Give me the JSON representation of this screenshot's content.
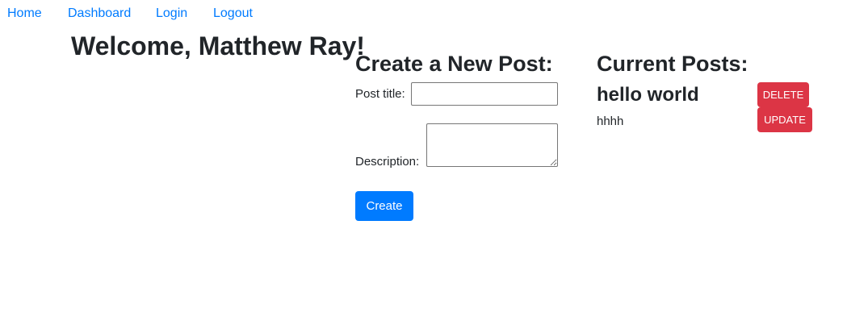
{
  "nav": {
    "links": [
      {
        "label": "Home"
      },
      {
        "label": "Dashboard"
      },
      {
        "label": "Login"
      },
      {
        "label": "Logout"
      }
    ]
  },
  "welcome": {
    "text": "Welcome, Matthew Ray!"
  },
  "create_post": {
    "heading": "Create a New Post:",
    "title_label": "Post title:",
    "title_value": "",
    "description_label": "Description:",
    "description_value": "",
    "create_button": "Create"
  },
  "current_posts": {
    "heading": "Current Posts:",
    "posts": [
      {
        "title": "hello world",
        "description": "hhhh",
        "delete_label": "DELETE",
        "update_label": "UPDATE"
      }
    ]
  },
  "colors": {
    "link": "#007bff",
    "primary": "#007bff",
    "danger": "#dc3545",
    "text": "#212529"
  }
}
